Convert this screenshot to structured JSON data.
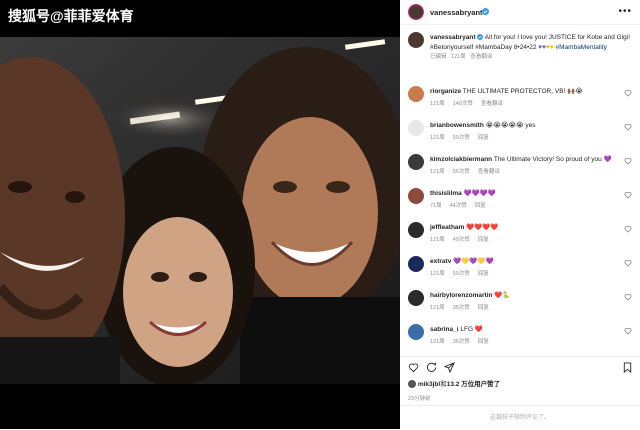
{
  "watermark": "搜狐号@菲菲爱体育",
  "post": {
    "username": "vanessabryant",
    "verified": true,
    "caption": "All for you! I love you! JUSTICE for Kobe and Gigi! #Betonyourself #MambaDay 8•24•22",
    "caption_tags": "#MambaMentality",
    "caption_emoji_colors": [
      "#7b4fc9",
      "#7b4fc9",
      "#f2c200",
      "#f2c200"
    ],
    "edited_label": "已编辑",
    "caption_time": "121周",
    "see_translation": "查看翻译",
    "likes_text": "13.2 万位用户赞了",
    "likes_user": "mik3jbl",
    "likes_prefix": "和",
    "post_time": "23分钟前",
    "comments_disabled": "这篇帖子限制评论了。"
  },
  "comments": [
    {
      "username": "riorganize",
      "text": "THE ULTIMATE PROTECTOR, VB!",
      "time": "121周",
      "likes": "149次赞",
      "reply": "查看翻译",
      "emoji": "🙌🏾😭",
      "avatar_color": "#c87a4d"
    },
    {
      "username": "brianbowensmith",
      "text": "",
      "time": "121周",
      "likes": "50次赞",
      "reply": "回复",
      "emoji": "😭😭😭😭😭 yes",
      "avatar_color": "#e7e7e7"
    },
    {
      "username": "kimzolciakbiermann",
      "text": "The Ultimate Victory! So proud of you",
      "time": "121周",
      "likes": "56次赞",
      "reply": "查看翻译",
      "emoji": "💜",
      "avatar_color": "#3a3a3a"
    },
    {
      "username": "thisislilma",
      "text": "",
      "time": "71周",
      "likes": "44次赞",
      "reply": "回复",
      "emoji": "💜💜💜💜",
      "avatar_color": "#8d4b3c"
    },
    {
      "username": "jeffleatham",
      "text": "",
      "time": "121周",
      "likes": "49次赞",
      "reply": "回复",
      "emoji": "❤️❤️❤️❤️",
      "avatar_color": "#2b2b2b"
    },
    {
      "username": "extratv",
      "text": "",
      "time": "121周",
      "likes": "50次赞",
      "reply": "回复",
      "emoji": "💜💛💜💛💜",
      "avatar_color": "#1c2a5a"
    },
    {
      "username": "hairbylorenzomartin",
      "text": "",
      "time": "121周",
      "likes": "35次赞",
      "reply": "回复",
      "emoji": "❤️🐍",
      "avatar_color": "#2a2a2a"
    },
    {
      "username": "sabrina_i",
      "text": "LFG",
      "time": "121周",
      "likes": "36次赞",
      "reply": "回复",
      "emoji": "❤️",
      "avatar_color": "#3b6ea5"
    }
  ],
  "icons": [
    "heart-icon",
    "comment-icon",
    "share-icon",
    "bookmark-icon",
    "more-icon",
    "verified-icon"
  ],
  "colors": {
    "verified": "#3897f0",
    "meta": "#8e8e8e",
    "text": "#262626",
    "photo_bg": "#000000"
  }
}
